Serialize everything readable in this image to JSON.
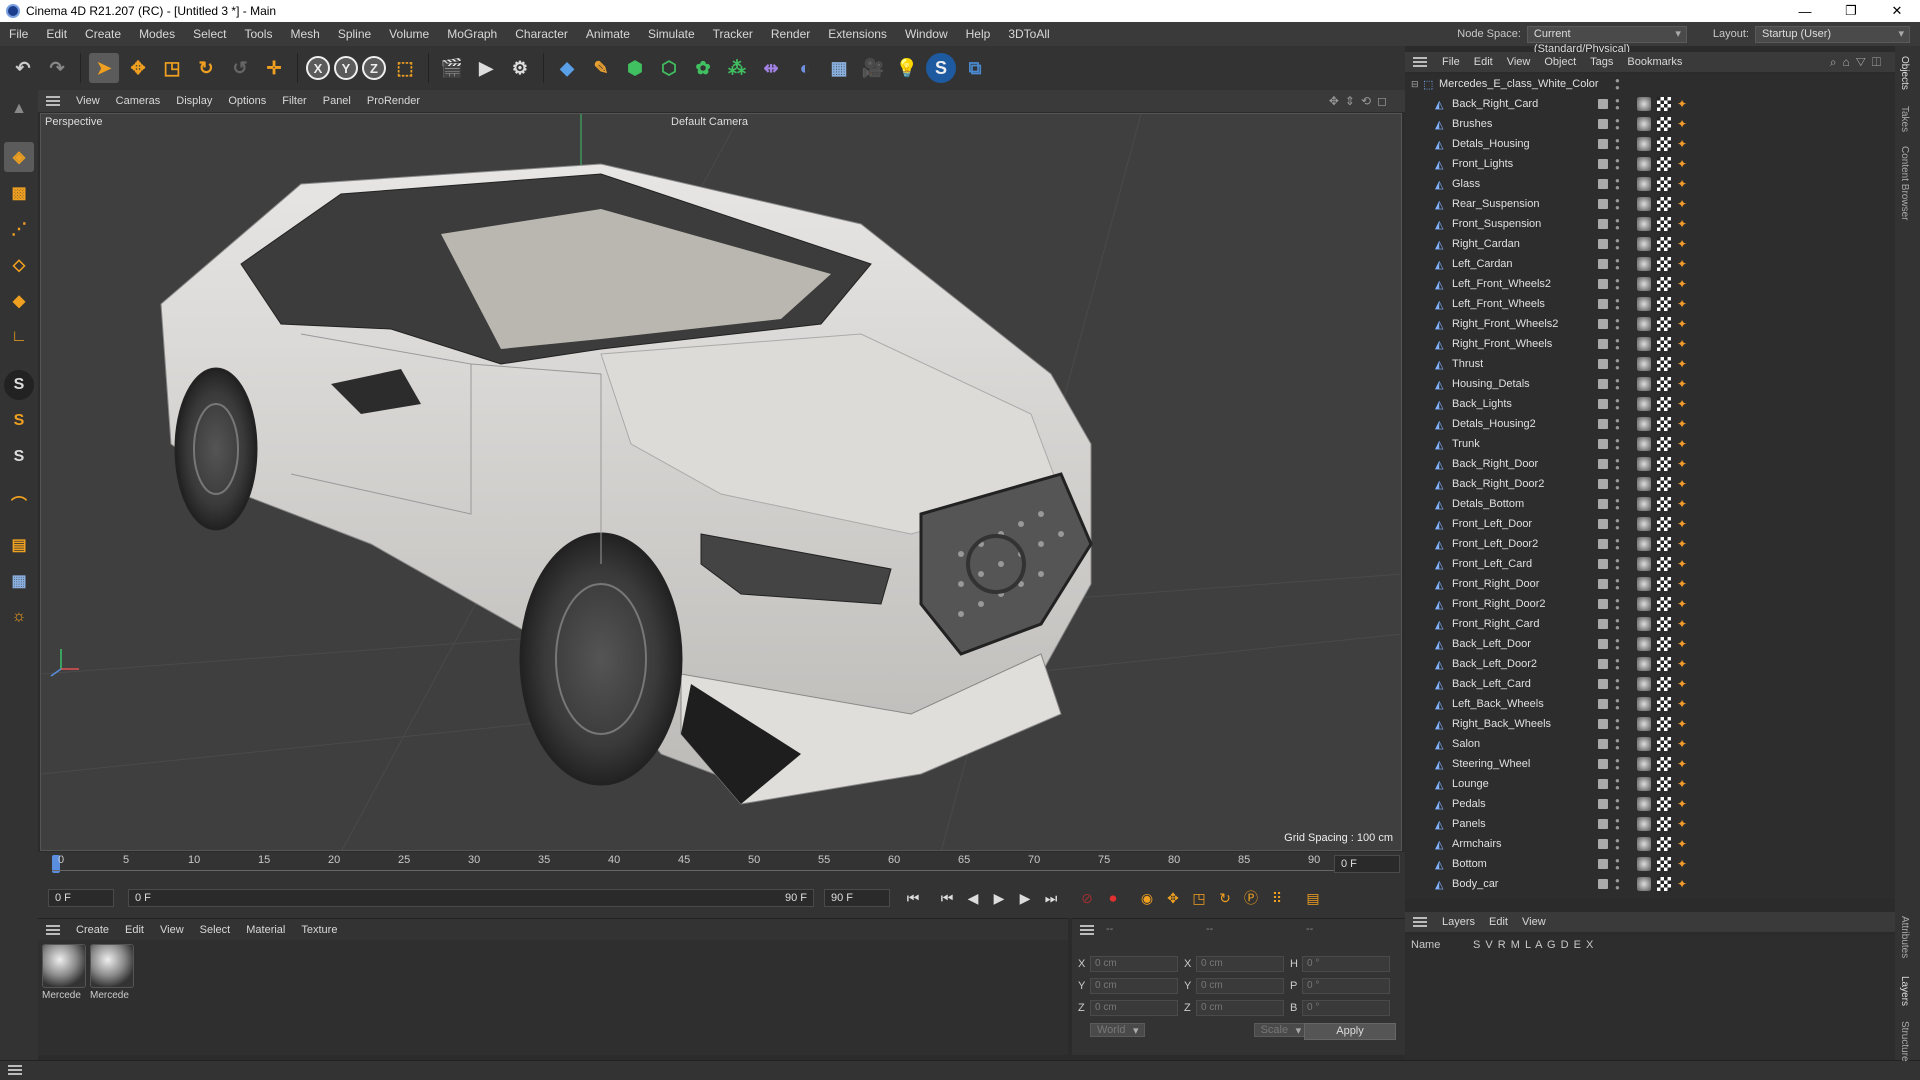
{
  "window": {
    "title": "Cinema 4D R21.207 (RC) - [Untitled 3 *] - Main",
    "controls": [
      "—",
      "❐",
      "✕"
    ]
  },
  "menu": {
    "items": [
      "File",
      "Edit",
      "Create",
      "Modes",
      "Select",
      "Tools",
      "Mesh",
      "Spline",
      "Volume",
      "MoGraph",
      "Character",
      "Animate",
      "Simulate",
      "Tracker",
      "Render",
      "Extensions",
      "Window",
      "Help",
      "3DToAll"
    ],
    "node_space_label": "Node Space:",
    "node_space_value": "Current (Standard/Physical)",
    "layout_label": "Layout:",
    "layout_value": "Startup (User)"
  },
  "viewport": {
    "menu": [
      "View",
      "Cameras",
      "Display",
      "Options",
      "Filter",
      "Panel",
      "ProRender"
    ],
    "name": "Perspective",
    "camera": "Default Camera",
    "grid_spacing": "Grid Spacing : 100 cm"
  },
  "timeline": {
    "ticks": [
      "0",
      "5",
      "10",
      "15",
      "20",
      "25",
      "30",
      "35",
      "40",
      "45",
      "50",
      "55",
      "60",
      "65",
      "70",
      "75",
      "80",
      "85",
      "90"
    ],
    "current_frame": "0 F",
    "start_field": "0 F",
    "range_start": "0 F",
    "range_end": "90 F",
    "end_field": "90 F"
  },
  "materials": {
    "menu": [
      "Create",
      "Edit",
      "View",
      "Select",
      "Material",
      "Texture"
    ],
    "items": [
      {
        "name": "Mercede"
      },
      {
        "name": "Mercede"
      }
    ]
  },
  "coordinates": {
    "header_cols": [
      "--",
      "--",
      "--"
    ],
    "rows": [
      {
        "a": "X",
        "av": "0 cm",
        "b": "X",
        "bv": "0 cm",
        "c": "H",
        "cv": "0 °"
      },
      {
        "a": "Y",
        "av": "0 cm",
        "b": "Y",
        "bv": "0 cm",
        "c": "P",
        "cv": "0 °"
      },
      {
        "a": "Z",
        "av": "0 cm",
        "b": "Z",
        "bv": "0 cm",
        "c": "B",
        "cv": "0 °"
      }
    ],
    "world": "World",
    "scale": "Scale",
    "apply": "Apply"
  },
  "object_manager": {
    "menu": [
      "File",
      "Edit",
      "View",
      "Object",
      "Tags",
      "Bookmarks"
    ],
    "root": "Mercedes_E_class_White_Color",
    "objects": [
      "Back_Right_Card",
      "Brushes",
      "Detals_Housing",
      "Front_Lights",
      "Glass",
      "Rear_Suspension",
      "Front_Suspension",
      "Right_Cardan",
      "Left_Cardan",
      "Left_Front_Wheels2",
      "Left_Front_Wheels",
      "Right_Front_Wheels2",
      "Right_Front_Wheels",
      "Thrust",
      "Housing_Detals",
      "Back_Lights",
      "Detals_Housing2",
      "Trunk",
      "Back_Right_Door",
      "Back_Right_Door2",
      "Detals_Bottom",
      "Front_Left_Door",
      "Front_Left_Door2",
      "Front_Left_Card",
      "Front_Right_Door",
      "Front_Right_Door2",
      "Front_Right_Card",
      "Back_Left_Door",
      "Back_Left_Door2",
      "Back_Left_Card",
      "Left_Back_Wheels",
      "Right_Back_Wheels",
      "Salon",
      "Steering_Wheel",
      "Lounge",
      "Pedals",
      "Panels",
      "Armchairs",
      "Bottom",
      "Body_car"
    ]
  },
  "layers": {
    "menu": [
      "Layers",
      "Edit",
      "View"
    ],
    "col_name": "Name",
    "col_flags": "S V R M L A G D E X"
  },
  "side_tabs": [
    "Objects",
    "Takes",
    "Content Browser",
    "Attributes",
    "Layers",
    "Structure"
  ]
}
